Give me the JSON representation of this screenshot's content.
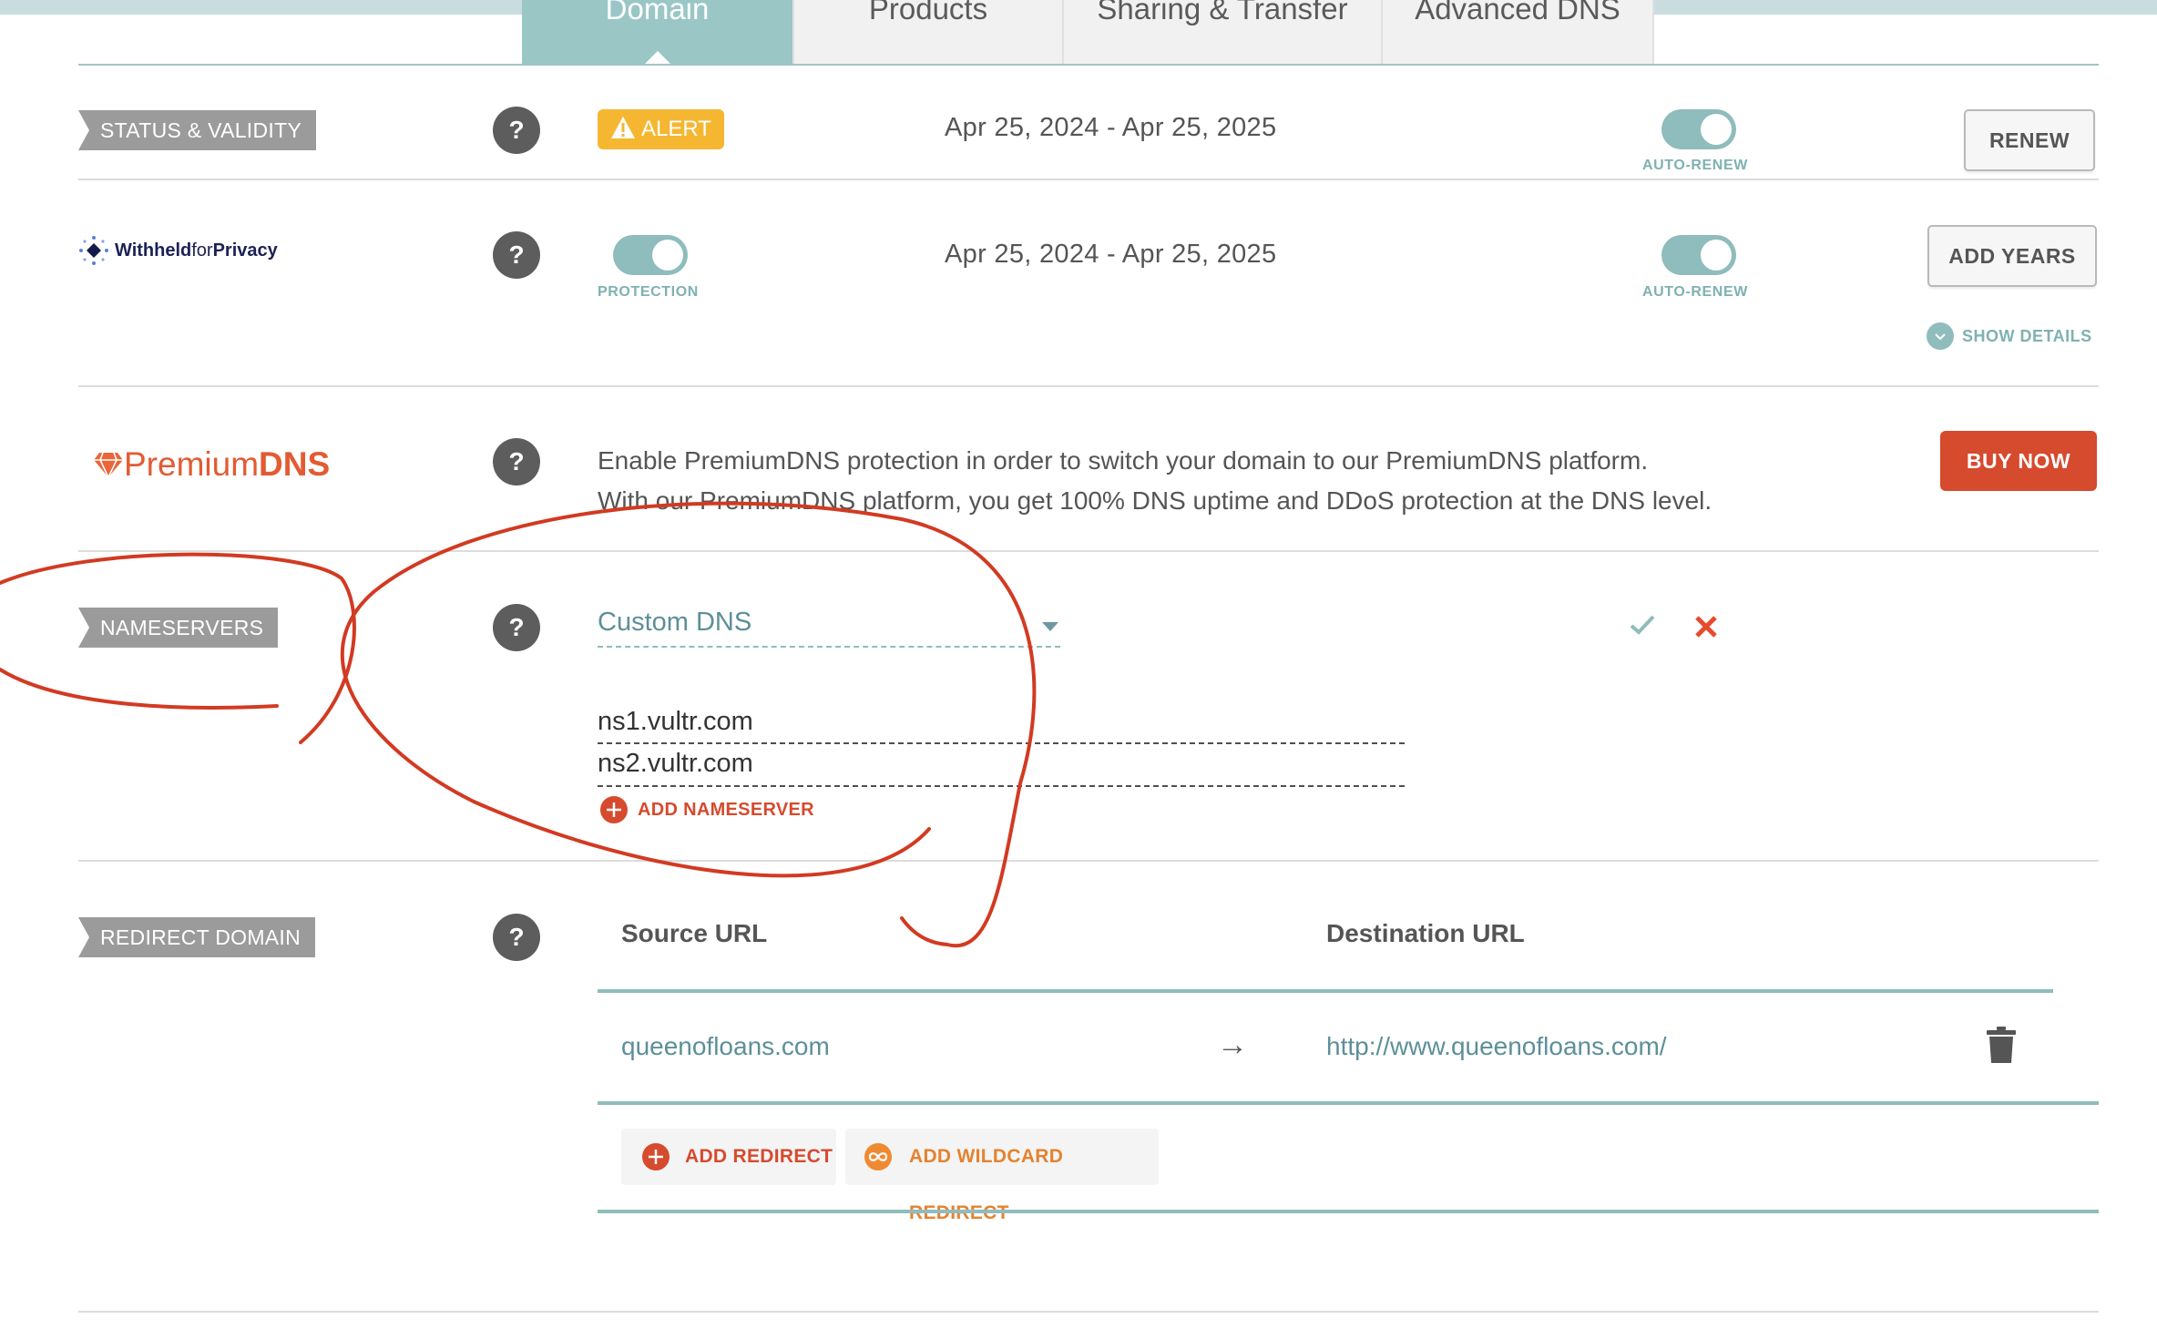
{
  "tabs": [
    {
      "label": "Domain",
      "active": true
    },
    {
      "label": "Products",
      "active": false
    },
    {
      "label": "Sharing & Transfer",
      "active": false
    },
    {
      "label": "Advanced DNS",
      "active": false
    }
  ],
  "status": {
    "tag": "STATUS & VALIDITY",
    "help": "?",
    "alert": "ALERT",
    "dates": "Apr 25, 2024 - Apr 25, 2025",
    "autorenew_label": "AUTO-RENEW",
    "autorenew_on": true,
    "renew_button": "RENEW"
  },
  "privacy": {
    "brand_prefix": "Withheld",
    "brand_mid": "for",
    "brand_suffix": "Privacy",
    "help": "?",
    "protection_label": "PROTECTION",
    "protection_on": true,
    "dates": "Apr 25, 2024 - Apr 25, 2025",
    "autorenew_label": "AUTO-RENEW",
    "autorenew_on": true,
    "add_years_button": "ADD YEARS",
    "show_details": "SHOW DETAILS"
  },
  "premium": {
    "brand_prefix": "Premium",
    "brand_suffix": "DNS",
    "help": "?",
    "line1": "Enable PremiumDNS protection in order to switch your domain to our PremiumDNS platform.",
    "line2": "With our PremiumDNS platform, you get 100% DNS uptime and DDoS protection at the DNS level.",
    "buy_button": "BUY NOW"
  },
  "nameservers": {
    "tag": "NAMESERVERS",
    "help": "?",
    "selected": "Custom DNS",
    "servers": [
      "ns1.vultr.com",
      "ns2.vultr.com"
    ],
    "add_label": "ADD NAMESERVER"
  },
  "redirect": {
    "tag": "REDIRECT DOMAIN",
    "help": "?",
    "source_header": "Source URL",
    "dest_header": "Destination URL",
    "source": "queenofloans.com",
    "arrow": "→",
    "destination": "http://www.queenofloans.com/",
    "add_redirect": "ADD REDIRECT",
    "add_wildcard": "ADD WILDCARD REDIRECT"
  },
  "colors": {
    "teal": "#8fbcbc",
    "alert": "#f5b731",
    "danger": "#d64a2e",
    "annotation": "#d23a22"
  }
}
